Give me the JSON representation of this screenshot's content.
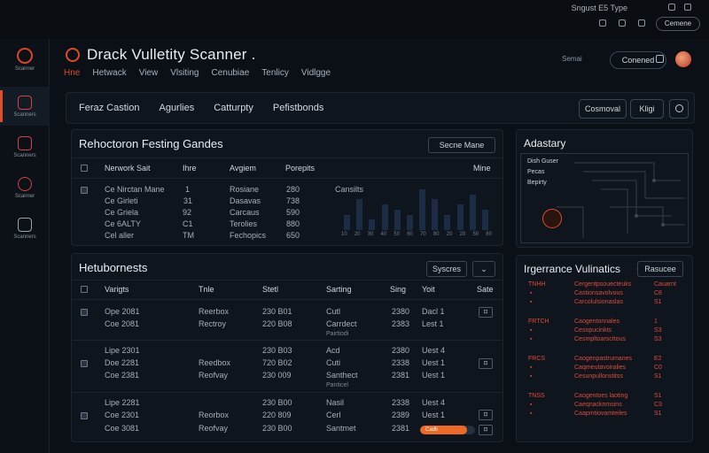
{
  "system": {
    "info": "Sngust E5 Type"
  },
  "topbar": {
    "pill": "Cemene"
  },
  "sidebar": {
    "logo_label": "Scanner",
    "items": [
      {
        "label": "Scanners",
        "icon": "cube-icon",
        "active": true
      },
      {
        "label": "Scanners",
        "icon": "shield-icon",
        "active": false
      },
      {
        "label": "Scanner",
        "icon": "target-icon",
        "active": false
      },
      {
        "label": "Scanners",
        "icon": "network-icon",
        "active": false
      }
    ]
  },
  "header": {
    "title": "Drack Vulletity Scanner .",
    "nav": [
      "Hne",
      "Hetwack",
      "View",
      "Vlsiting",
      "Cenubiae",
      "Tenlicy",
      "Vidlgge"
    ],
    "search_label": "Semai",
    "button": "Conened"
  },
  "tabbar": {
    "tabs": [
      "Feraz Castion",
      "Agurlies",
      "Catturpty",
      "Pefistbonds"
    ],
    "cta": "Cosmoval",
    "cta2": "Kligi"
  },
  "panel1": {
    "title": "Rehoctoron Festing Gandes",
    "dropdown": "Secne Mane",
    "columns": [
      "Nerwork Sait",
      "Ihre",
      "Avgiem",
      "Porepits",
      "Mine"
    ],
    "rows": [
      {
        "name": "Ce Nirctan Mane",
        "n": "1",
        "type": "Rosiane",
        "val": "280"
      },
      {
        "name": "Ce Girleti",
        "n": "31",
        "type": "Dasavas",
        "val": "738"
      },
      {
        "name": "Ce Griela",
        "n": "92",
        "type": "Carcaus",
        "val": "590"
      },
      {
        "name": "Ce 6ALTY",
        "n": "C1",
        "type": "Terolies",
        "val": "880"
      },
      {
        "name": "Cel aller",
        "n": "TM",
        "type": "Fechopics",
        "val": "650"
      }
    ],
    "chart_label": "Cansilts",
    "chart_ticks": [
      "10",
      "20",
      "30",
      "40",
      "50",
      "60",
      "70",
      "80",
      "20",
      "20",
      "50",
      "80"
    ]
  },
  "chart_data": {
    "type": "bar",
    "title": "",
    "categories": [
      "10",
      "20",
      "30",
      "40",
      "50",
      "60",
      "70",
      "80",
      "20",
      "20",
      "50",
      "80"
    ],
    "values": [
      3,
      6,
      2,
      5,
      4,
      3,
      8,
      6,
      3,
      5,
      7,
      4
    ],
    "ylim": [
      0,
      9
    ]
  },
  "panel2": {
    "title": "Hetubornests",
    "button1": "Syscres",
    "columns": [
      "Varigts",
      "Tnle",
      "Stetl",
      "Sarting",
      "Sing",
      "Yoit",
      "Sate"
    ],
    "rows": [
      {
        "a": "Ope 2081",
        "b": "Reerbox",
        "c": "230 B01",
        "d": "Cutl",
        "e": "2380",
        "f": "Dacl 1"
      },
      {
        "a": "Coe 2081",
        "b": "Rectroy",
        "c": "220 B08",
        "d": "Carrdect",
        "e": "2383",
        "f": "Lest 1",
        "sub": "Pairtiodi"
      },
      {
        "a": "Lipe 2301",
        "b": "",
        "c": "230 B03",
        "d": "Acd",
        "e": "2380",
        "f": "Uest 4"
      },
      {
        "a": "Doe 2281",
        "b": "Reedbox",
        "c": "720 B02",
        "d": "Cuti",
        "e": "2338",
        "f": "Uest 1"
      },
      {
        "a": "Coe 2381",
        "b": "Reofvay",
        "c": "230 009",
        "d": "Santhect",
        "e": "2381",
        "f": "Uest 1",
        "sub": "Panticel"
      },
      {
        "a": "Lipe 2281",
        "b": "",
        "c": "230 B00",
        "d": "Nasil",
        "e": "2338",
        "f": "Uest 4"
      },
      {
        "a": "Coe 2301",
        "b": "Reorbox",
        "c": "220 809",
        "d": "Cerl",
        "e": "2389",
        "f": "Uest 1"
      },
      {
        "a": "Coe 3081",
        "b": "Reofvay",
        "c": "230 B00",
        "d": "Santmet",
        "e": "2381",
        "f": ""
      }
    ],
    "progress_label": "Cadli",
    "progress": 0.86
  },
  "panel3": {
    "title": "Adastary",
    "lines": [
      "Dish Guser",
      "Pecas",
      "Bepirty"
    ]
  },
  "panel4": {
    "title": "Irgerrance Vulinatics",
    "dropdown": "Rasucee",
    "groups": [
      {
        "head": "TNHH",
        "items": [
          "Cergentpsouecteuks",
          "Castionsavolvous",
          "Carcolulsionaslas"
        ],
        "right": [
          "Cauarnt",
          "C8",
          "S1"
        ]
      },
      {
        "head": "FRTCH",
        "items": [
          "Caogentonnales",
          "Cesnpucinkts",
          "Cesmpltoarscttous"
        ],
        "right": [
          "1",
          "S3",
          "S3"
        ]
      },
      {
        "head": "FRCS",
        "items": [
          "Caogenpastrumanes",
          "Caqmeutavoiralies",
          "Cesunpullonstitss"
        ],
        "right": [
          "E2",
          "C0",
          "S1"
        ]
      },
      {
        "head": "TNSS",
        "items": [
          "Caogentoes laoting",
          "Caeqnacknmsins",
          "Caapmtiovamteiles"
        ],
        "right": [
          "S1",
          "C3",
          "S1"
        ]
      }
    ]
  }
}
